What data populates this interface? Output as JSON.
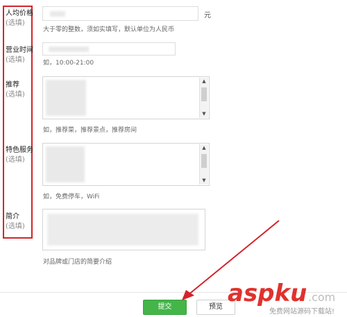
{
  "form": {
    "price": {
      "label": "人均价格",
      "optional": "(选填)",
      "unit": "元",
      "hint": "大于零的整数，须如实填写，默认单位为人民币"
    },
    "hours": {
      "label": "营业时间",
      "optional": "(选填)",
      "hint": "如，10:00-21:00"
    },
    "recommend": {
      "label": "推荐",
      "optional": "(选填)",
      "hint": "如，推荐菜，推荐景点，推荐房间"
    },
    "services": {
      "label": "特色服务",
      "optional": "(选填)",
      "hint": "如，免费停车，WiFi"
    },
    "intro": {
      "label": "简介",
      "optional": "(选填)",
      "hint": "对品牌或门店的简要介绍"
    }
  },
  "buttons": {
    "submit": "提交",
    "preview": "预览"
  },
  "watermark": {
    "brand": "aspku",
    "suffix": ".com",
    "slogan": "免费网站源码下载站!"
  },
  "colors": {
    "highlight": "#d3242a",
    "submit": "#44b549",
    "watermark": "#e0322e"
  }
}
